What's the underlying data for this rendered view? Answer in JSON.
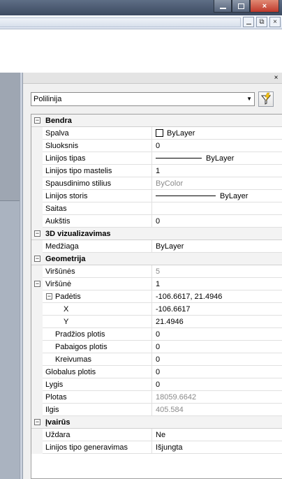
{
  "palette": {
    "object_type": "Polilinija",
    "close_symbol": "×"
  },
  "window": {
    "minimize_label": "",
    "maximize_label": "",
    "close_label": "×",
    "mdi_restore_label": "⧉",
    "mdi_close_label": "×"
  },
  "sections": [
    {
      "title": "Bendra",
      "rows": [
        {
          "name": "Spalva",
          "value": "ByLayer"
        },
        {
          "name": "Sluoksnis",
          "value": "0"
        },
        {
          "name": "Linijos tipas",
          "value": "ByLayer"
        },
        {
          "name": "Linijos tipo mastelis",
          "value": "1"
        },
        {
          "name": "Spausdinimo stilius",
          "value": "ByColor"
        },
        {
          "name": "Linijos storis",
          "value": "ByLayer"
        },
        {
          "name": "Saitas",
          "value": ""
        },
        {
          "name": "Aukštis",
          "value": "0"
        }
      ]
    },
    {
      "title": "3D vizualizavimas",
      "rows": [
        {
          "name": "Medžiaga",
          "value": "ByLayer"
        }
      ]
    },
    {
      "title": "Geometrija",
      "rows": [
        {
          "name": "Viršūnės",
          "value": "5"
        },
        {
          "name": "Viršūnė",
          "value": "1"
        },
        {
          "name": "Padėtis",
          "value": "-106.6617, 21.4946"
        },
        {
          "name": "X",
          "value": "-106.6617"
        },
        {
          "name": "Y",
          "value": "21.4946"
        },
        {
          "name": "Pradžios plotis",
          "value": "0"
        },
        {
          "name": "Pabaigos plotis",
          "value": "0"
        },
        {
          "name": "Kreivumas",
          "value": "0"
        },
        {
          "name": "Globalus plotis",
          "value": "0"
        },
        {
          "name": "Lygis",
          "value": "0"
        },
        {
          "name": "Plotas",
          "value": "18059.6642"
        },
        {
          "name": "Ilgis",
          "value": "405.584"
        }
      ]
    },
    {
      "title": "Įvairūs",
      "rows": [
        {
          "name": "Uždara",
          "value": "Ne"
        },
        {
          "name": "Linijos tipo generavimas",
          "value": "Išjungta"
        }
      ]
    }
  ]
}
